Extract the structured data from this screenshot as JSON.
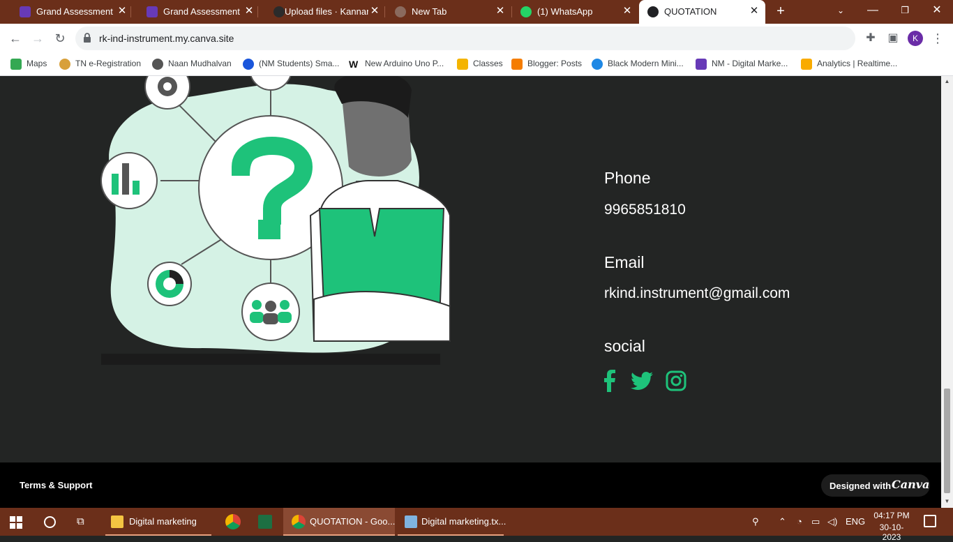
{
  "browser": {
    "tabs": [
      {
        "title": "Grand Assessment Di",
        "icon": "forms-icon",
        "active": false
      },
      {
        "title": "Grand Assessment Di",
        "icon": "forms-icon",
        "active": false
      },
      {
        "title": "Upload files · Kannan",
        "icon": "github-icon",
        "active": false
      },
      {
        "title": "New Tab",
        "icon": "chrome-icon",
        "active": false
      },
      {
        "title": "(1) WhatsApp",
        "icon": "whatsapp-icon",
        "active": false
      },
      {
        "title": "QUOTATION",
        "icon": "canva-icon",
        "active": true
      }
    ],
    "url": "rk-ind-instrument.my.canva.site",
    "profile_initial": "K",
    "bookmarks": [
      {
        "label": "Maps"
      },
      {
        "label": "TN e-Registration"
      },
      {
        "label": "Naan Mudhalvan"
      },
      {
        "label": "(NM Students) Sma..."
      },
      {
        "label": "New Arduino Uno P..."
      },
      {
        "label": "Classes"
      },
      {
        "label": "Blogger: Posts"
      },
      {
        "label": "Black Modern Mini..."
      },
      {
        "label": "NM - Digital Marke..."
      },
      {
        "label": "Analytics | Realtime..."
      }
    ]
  },
  "contact": {
    "phone_heading": "Phone",
    "phone_value": "9965851810",
    "email_heading": "Email",
    "email_value": "rkind.instrument@gmail.com",
    "social_heading": "social",
    "social_icons": [
      "facebook-icon",
      "twitter-icon",
      "instagram-icon"
    ],
    "accent_color": "#1ec27a"
  },
  "footer": {
    "terms_label": "Terms & Support",
    "designed_label": "Designed with",
    "brand_label": "Canva"
  },
  "taskbar": {
    "items": [
      {
        "label": "Digital marketing"
      },
      {
        "label": ""
      },
      {
        "label": ""
      },
      {
        "label": "QUOTATION - Goo..."
      },
      {
        "label": "Digital marketing.tx..."
      }
    ],
    "language": "ENG",
    "time": "04:17 PM",
    "date": "30-10-2023"
  }
}
